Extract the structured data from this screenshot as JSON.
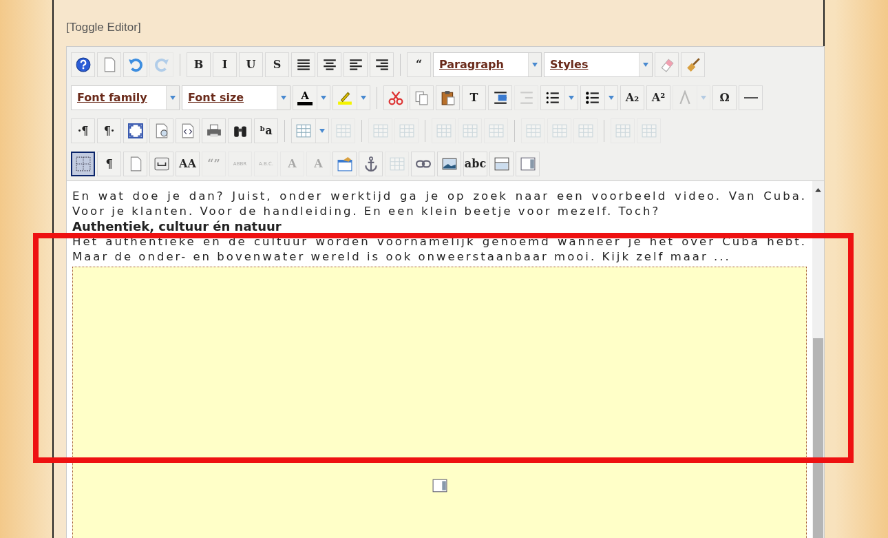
{
  "toggle_link": "[Toggle Editor]",
  "toolbar": {
    "bars": [
      [
        {
          "kind": "button",
          "disabled": false
        },
        {
          "kind": "button",
          "disabled": false
        },
        {
          "kind": "button",
          "disabled": false
        },
        {
          "kind": "button",
          "disabled": true
        },
        {
          "kind": "separator"
        },
        {
          "kind": "button",
          "label": "B",
          "disabled": false
        },
        {
          "kind": "button",
          "label": "I",
          "disabled": false
        },
        {
          "kind": "button",
          "label": "U",
          "disabled": false
        },
        {
          "kind": "button",
          "label": "S",
          "disabled": false
        },
        {
          "kind": "button",
          "disabled": false
        },
        {
          "kind": "button",
          "disabled": false
        },
        {
          "kind": "button",
          "disabled": false
        },
        {
          "kind": "button",
          "disabled": false
        },
        {
          "kind": "separator"
        },
        {
          "kind": "button",
          "label": "“",
          "disabled": false
        },
        {
          "kind": "select",
          "label": "Paragraph"
        },
        {
          "kind": "select",
          "label": "Styles"
        },
        {
          "kind": "button",
          "disabled": false
        },
        {
          "kind": "button",
          "disabled": false
        }
      ],
      [
        {
          "kind": "select",
          "label": "Font family"
        },
        {
          "kind": "select",
          "label": "Font size"
        },
        {
          "kind": "split",
          "label": "A",
          "disabled": false
        },
        {
          "kind": "split",
          "disabled": false
        },
        {
          "kind": "separator"
        },
        {
          "kind": "button",
          "disabled": false
        },
        {
          "kind": "button",
          "disabled": false
        },
        {
          "kind": "button",
          "disabled": false
        },
        {
          "kind": "button",
          "label": "T",
          "disabled": false
        },
        {
          "kind": "button",
          "disabled": false
        },
        {
          "kind": "button",
          "disabled": true
        },
        {
          "kind": "split",
          "disabled": false
        },
        {
          "kind": "split",
          "disabled": false
        },
        {
          "kind": "button",
          "label": "A₂",
          "disabled": false
        },
        {
          "kind": "button",
          "label": "A²",
          "disabled": false
        },
        {
          "kind": "split",
          "disabled": true
        },
        {
          "kind": "button",
          "label": "Ω",
          "disabled": false
        },
        {
          "kind": "button",
          "disabled": false
        }
      ],
      [
        {
          "kind": "button",
          "label": "·¶",
          "disabled": false
        },
        {
          "kind": "button",
          "label": "¶·",
          "disabled": false
        },
        {
          "kind": "button",
          "disabled": false
        },
        {
          "kind": "button",
          "disabled": false
        },
        {
          "kind": "button",
          "disabled": false
        },
        {
          "kind": "button",
          "disabled": false
        },
        {
          "kind": "button",
          "disabled": false
        },
        {
          "kind": "button",
          "label": "ᵇa",
          "disabled": false
        },
        {
          "kind": "separator"
        },
        {
          "kind": "split",
          "disabled": false
        },
        {
          "kind": "button",
          "disabled": true
        },
        {
          "kind": "separator"
        },
        {
          "kind": "button",
          "disabled": true
        },
        {
          "kind": "button",
          "disabled": true
        },
        {
          "kind": "separator"
        },
        {
          "kind": "button",
          "disabled": true
        },
        {
          "kind": "button",
          "disabled": true
        },
        {
          "kind": "button",
          "disabled": true
        },
        {
          "kind": "separator"
        },
        {
          "kind": "button",
          "disabled": true
        },
        {
          "kind": "button",
          "disabled": true
        },
        {
          "kind": "button",
          "disabled": true
        },
        {
          "kind": "separator"
        },
        {
          "kind": "button",
          "disabled": true
        },
        {
          "kind": "button",
          "disabled": true
        }
      ],
      [
        {
          "kind": "button",
          "disabled": false,
          "selected": true
        },
        {
          "kind": "button",
          "label": "¶",
          "disabled": false,
          "selected": false
        },
        {
          "kind": "button",
          "disabled": false,
          "selected": false
        },
        {
          "kind": "button",
          "disabled": false,
          "selected": false
        },
        {
          "kind": "button",
          "label": "AA",
          "disabled": false,
          "selected": false
        },
        {
          "kind": "button",
          "label": "“”",
          "disabled": true,
          "selected": false
        },
        {
          "kind": "button",
          "label": "ABBR",
          "disabled": true,
          "selected": false
        },
        {
          "kind": "button",
          "label": "A.B.C.",
          "disabled": true,
          "selected": false
        },
        {
          "kind": "button",
          "label": "A",
          "disabled": true,
          "selected": false
        },
        {
          "kind": "button",
          "label": "A",
          "disabled": true,
          "selected": false
        },
        {
          "kind": "button",
          "disabled": false,
          "selected": false
        },
        {
          "kind": "button",
          "disabled": false,
          "selected": false
        },
        {
          "kind": "button",
          "disabled": true,
          "selected": false
        },
        {
          "kind": "button",
          "disabled": false,
          "selected": false
        },
        {
          "kind": "button",
          "disabled": false,
          "selected": false
        },
        {
          "kind": "button",
          "label": "abc",
          "disabled": false,
          "selected": false
        },
        {
          "kind": "button",
          "disabled": false,
          "selected": false
        },
        {
          "kind": "button",
          "disabled": false,
          "selected": false
        }
      ]
    ]
  },
  "content": [
    {
      "kind": "paragraph",
      "lines": [
        "En wat doe je dan? Juist, onder werktijd ga je op zoek naar een voorbeeld video. Van Cuba.",
        "Voor je klanten. Voor de handleiding. En een klein beetje voor mezelf. Toch?"
      ]
    },
    {
      "kind": "heading",
      "text": "Authentiek, cultuur én natuur"
    },
    {
      "kind": "paragraph",
      "lines": [
        "Het authentieke en de cultuur worden voornamelijk genoemd wanneer je het over Cuba hebt.",
        "Maar de onder- en bovenwater wereld is ook onweerstaanbaar mooi. Kijk zelf maar ..."
      ]
    },
    {
      "kind": "embed"
    }
  ]
}
